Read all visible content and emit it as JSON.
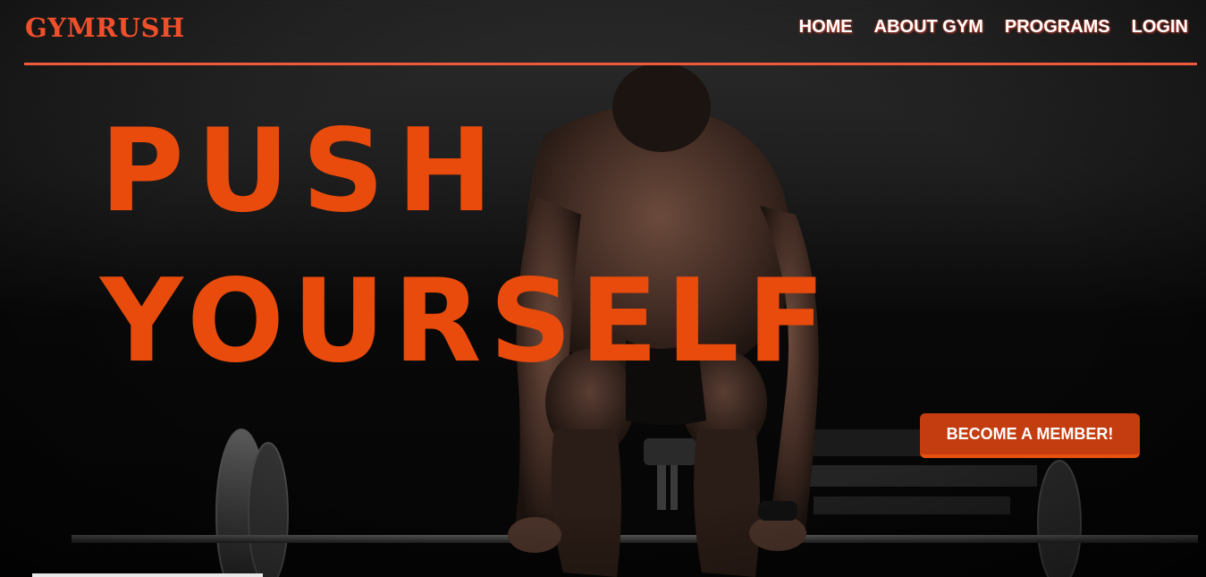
{
  "brand": {
    "name": "GYMRUSH"
  },
  "nav": {
    "items": [
      {
        "label": "HOME"
      },
      {
        "label": "ABOUT GYM"
      },
      {
        "label": "PROGRAMS"
      },
      {
        "label": "LOGIN"
      }
    ]
  },
  "hero": {
    "headline_line1": "PUSH",
    "headline_line2": "YOURSELF",
    "cta_label": "BECOME A MEMBER!",
    "image_subject": "athlete-deadlift-photo"
  },
  "colors": {
    "accent": "#e84b0c",
    "brand": "#f04f2b",
    "nav_rule": "#ef5a3c",
    "cta_bg": "#c43d10",
    "background": "#0a0a0a"
  }
}
